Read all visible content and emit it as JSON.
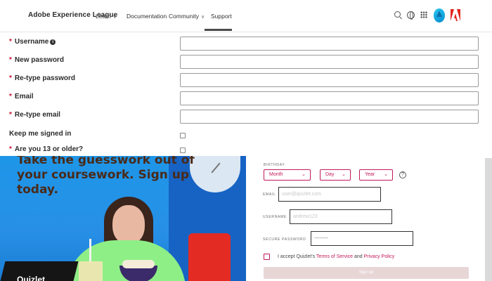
{
  "nav": {
    "brand": "Adobe Experience League",
    "items": [
      {
        "label": "Learn",
        "caret": "∨"
      },
      {
        "label": "Documentation",
        "caret": ""
      },
      {
        "label": "Community",
        "caret": "∨"
      },
      {
        "label": "Support",
        "caret": ""
      }
    ],
    "active": "Support"
  },
  "form": {
    "required_mark": "*",
    "fields": [
      {
        "label": "Username",
        "required": true,
        "info": "i"
      },
      {
        "label": "New password",
        "required": true
      },
      {
        "label": "Re-type password",
        "required": true
      },
      {
        "label": "Email",
        "required": true
      },
      {
        "label": "Re-type email",
        "required": true
      }
    ],
    "keep_signed_in": "Keep me signed in",
    "age_check": "Are you 13 or older?"
  },
  "promo": {
    "headline": "Take the guesswork out of your coursework. Sign up today.",
    "brand": "Quizlet"
  },
  "signup": {
    "birthday_label": "BIRTHDAY",
    "month": "Month",
    "day": "Day",
    "year": "Year",
    "help": "?",
    "email_label": "EMAIL",
    "email_placeholder": "user@quizlet.com",
    "username_label": "USERNAME",
    "username_placeholder": "andrew123",
    "password_label": "SECURE PASSWORD",
    "password_placeholder": "••••••••",
    "agree_prefix": "I accept Quizlet's",
    "terms": "Terms of Service",
    "and": "and",
    "privacy": "Privacy Policy",
    "button": "Sign up"
  },
  "colors": {
    "required": "#c8102e",
    "accent": "#c2185b",
    "promo_blue": "#1e96e8"
  }
}
